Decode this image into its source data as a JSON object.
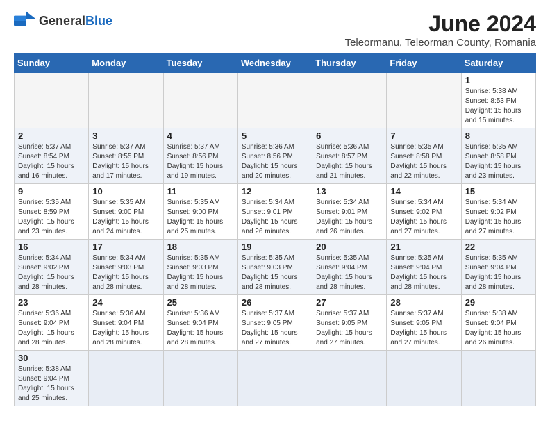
{
  "logo": {
    "text_black": "General",
    "text_blue": "Blue"
  },
  "header": {
    "month_year": "June 2024",
    "location": "Teleormanu, Teleorman County, Romania"
  },
  "weekdays": [
    "Sunday",
    "Monday",
    "Tuesday",
    "Wednesday",
    "Thursday",
    "Friday",
    "Saturday"
  ],
  "weeks": [
    [
      {
        "day": "",
        "info": ""
      },
      {
        "day": "",
        "info": ""
      },
      {
        "day": "",
        "info": ""
      },
      {
        "day": "",
        "info": ""
      },
      {
        "day": "",
        "info": ""
      },
      {
        "day": "",
        "info": ""
      },
      {
        "day": "1",
        "info": "Sunrise: 5:38 AM\nSunset: 8:53 PM\nDaylight: 15 hours and 15 minutes."
      }
    ],
    [
      {
        "day": "2",
        "info": "Sunrise: 5:37 AM\nSunset: 8:54 PM\nDaylight: 15 hours and 16 minutes."
      },
      {
        "day": "3",
        "info": "Sunrise: 5:37 AM\nSunset: 8:55 PM\nDaylight: 15 hours and 17 minutes."
      },
      {
        "day": "4",
        "info": "Sunrise: 5:37 AM\nSunset: 8:56 PM\nDaylight: 15 hours and 19 minutes."
      },
      {
        "day": "5",
        "info": "Sunrise: 5:36 AM\nSunset: 8:56 PM\nDaylight: 15 hours and 20 minutes."
      },
      {
        "day": "6",
        "info": "Sunrise: 5:36 AM\nSunset: 8:57 PM\nDaylight: 15 hours and 21 minutes."
      },
      {
        "day": "7",
        "info": "Sunrise: 5:35 AM\nSunset: 8:58 PM\nDaylight: 15 hours and 22 minutes."
      },
      {
        "day": "8",
        "info": "Sunrise: 5:35 AM\nSunset: 8:58 PM\nDaylight: 15 hours and 23 minutes."
      }
    ],
    [
      {
        "day": "9",
        "info": "Sunrise: 5:35 AM\nSunset: 8:59 PM\nDaylight: 15 hours and 23 minutes."
      },
      {
        "day": "10",
        "info": "Sunrise: 5:35 AM\nSunset: 9:00 PM\nDaylight: 15 hours and 24 minutes."
      },
      {
        "day": "11",
        "info": "Sunrise: 5:35 AM\nSunset: 9:00 PM\nDaylight: 15 hours and 25 minutes."
      },
      {
        "day": "12",
        "info": "Sunrise: 5:34 AM\nSunset: 9:01 PM\nDaylight: 15 hours and 26 minutes."
      },
      {
        "day": "13",
        "info": "Sunrise: 5:34 AM\nSunset: 9:01 PM\nDaylight: 15 hours and 26 minutes."
      },
      {
        "day": "14",
        "info": "Sunrise: 5:34 AM\nSunset: 9:02 PM\nDaylight: 15 hours and 27 minutes."
      },
      {
        "day": "15",
        "info": "Sunrise: 5:34 AM\nSunset: 9:02 PM\nDaylight: 15 hours and 27 minutes."
      }
    ],
    [
      {
        "day": "16",
        "info": "Sunrise: 5:34 AM\nSunset: 9:02 PM\nDaylight: 15 hours and 28 minutes."
      },
      {
        "day": "17",
        "info": "Sunrise: 5:34 AM\nSunset: 9:03 PM\nDaylight: 15 hours and 28 minutes."
      },
      {
        "day": "18",
        "info": "Sunrise: 5:35 AM\nSunset: 9:03 PM\nDaylight: 15 hours and 28 minutes."
      },
      {
        "day": "19",
        "info": "Sunrise: 5:35 AM\nSunset: 9:03 PM\nDaylight: 15 hours and 28 minutes."
      },
      {
        "day": "20",
        "info": "Sunrise: 5:35 AM\nSunset: 9:04 PM\nDaylight: 15 hours and 28 minutes."
      },
      {
        "day": "21",
        "info": "Sunrise: 5:35 AM\nSunset: 9:04 PM\nDaylight: 15 hours and 28 minutes."
      },
      {
        "day": "22",
        "info": "Sunrise: 5:35 AM\nSunset: 9:04 PM\nDaylight: 15 hours and 28 minutes."
      }
    ],
    [
      {
        "day": "23",
        "info": "Sunrise: 5:36 AM\nSunset: 9:04 PM\nDaylight: 15 hours and 28 minutes."
      },
      {
        "day": "24",
        "info": "Sunrise: 5:36 AM\nSunset: 9:04 PM\nDaylight: 15 hours and 28 minutes."
      },
      {
        "day": "25",
        "info": "Sunrise: 5:36 AM\nSunset: 9:04 PM\nDaylight: 15 hours and 28 minutes."
      },
      {
        "day": "26",
        "info": "Sunrise: 5:37 AM\nSunset: 9:05 PM\nDaylight: 15 hours and 27 minutes."
      },
      {
        "day": "27",
        "info": "Sunrise: 5:37 AM\nSunset: 9:05 PM\nDaylight: 15 hours and 27 minutes."
      },
      {
        "day": "28",
        "info": "Sunrise: 5:37 AM\nSunset: 9:05 PM\nDaylight: 15 hours and 27 minutes."
      },
      {
        "day": "29",
        "info": "Sunrise: 5:38 AM\nSunset: 9:04 PM\nDaylight: 15 hours and 26 minutes."
      }
    ],
    [
      {
        "day": "30",
        "info": "Sunrise: 5:38 AM\nSunset: 9:04 PM\nDaylight: 15 hours and 25 minutes."
      },
      {
        "day": "",
        "info": ""
      },
      {
        "day": "",
        "info": ""
      },
      {
        "day": "",
        "info": ""
      },
      {
        "day": "",
        "info": ""
      },
      {
        "day": "",
        "info": ""
      },
      {
        "day": "",
        "info": ""
      }
    ]
  ]
}
